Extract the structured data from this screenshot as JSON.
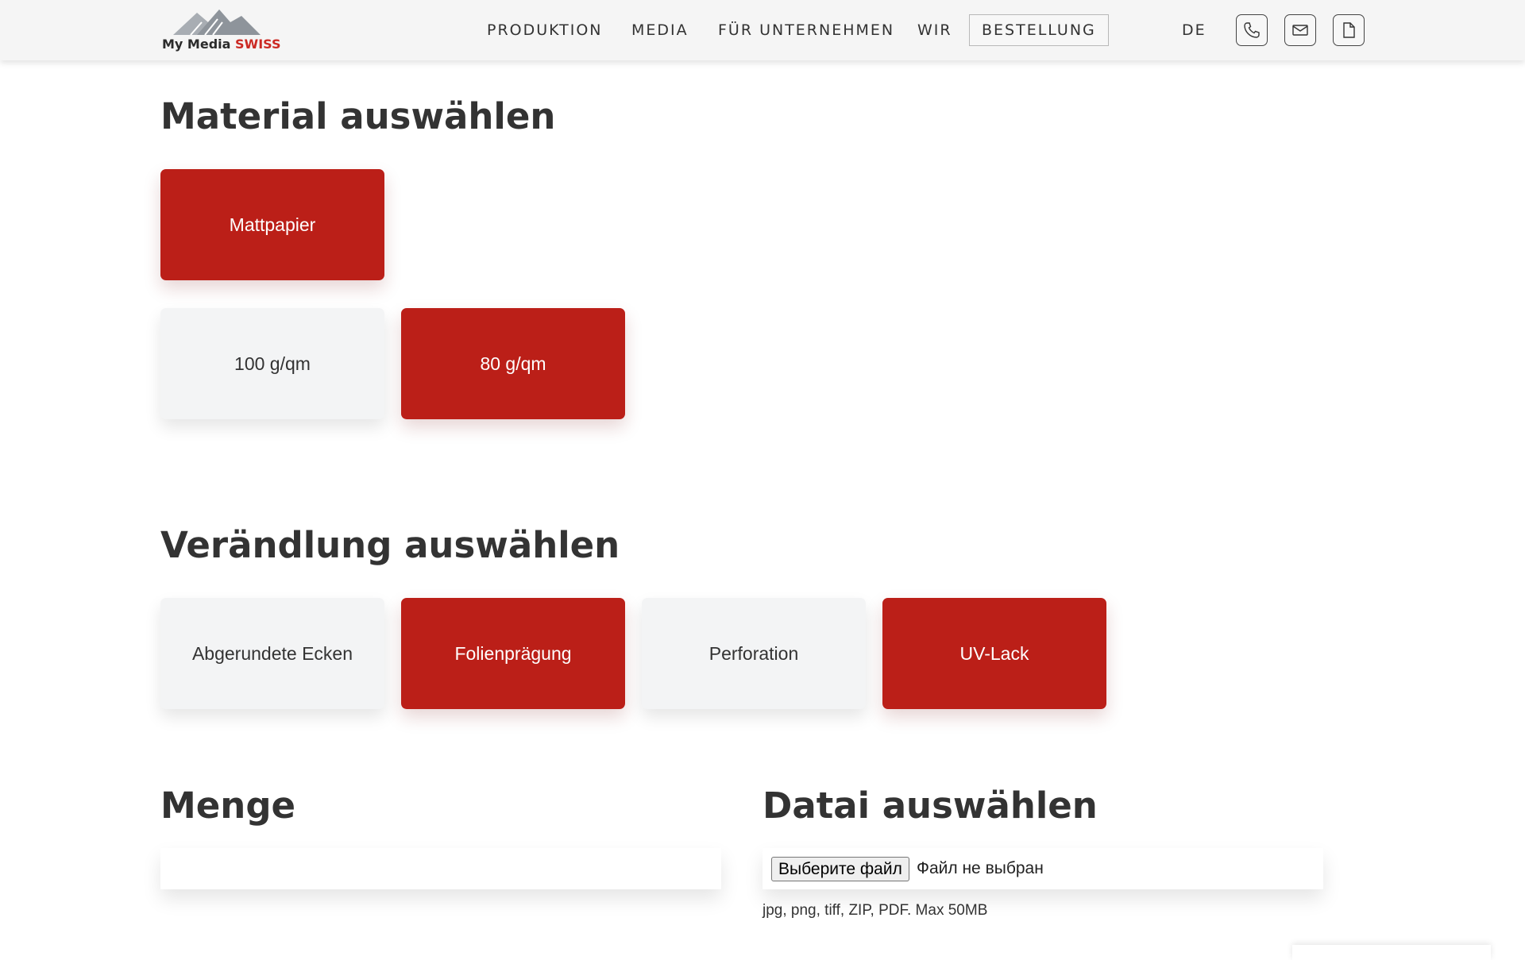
{
  "header": {
    "logo": {
      "text_main": "My Media",
      "text_accent": "SWISS"
    },
    "nav": [
      {
        "label": "PRODUKTION"
      },
      {
        "label": "MEDIA"
      },
      {
        "label": "FÜR UNTERNEHMEN"
      },
      {
        "label": "WIR"
      },
      {
        "label": "BESTELLUNG"
      }
    ],
    "language": "DE",
    "icons": [
      "phone-icon",
      "mail-icon",
      "document-icon"
    ]
  },
  "material": {
    "title": "Material auswählen",
    "type_options": [
      {
        "label": "Mattpapier",
        "selected": true
      }
    ],
    "weight_options": [
      {
        "label": "100 g/qm",
        "selected": false
      },
      {
        "label": "80 g/qm",
        "selected": true
      }
    ]
  },
  "finishing": {
    "title": "Verändlung auswählen",
    "options": [
      {
        "label": "Abgerundete Ecken",
        "selected": false
      },
      {
        "label": "Folienprägung",
        "selected": true
      },
      {
        "label": "Perforation",
        "selected": false
      },
      {
        "label": "UV-Lack",
        "selected": true
      }
    ]
  },
  "quantity": {
    "title": "Menge",
    "value": ""
  },
  "file": {
    "title": "Datai auswählen",
    "button_label": "Выберите файл",
    "status": "Файл не выбран",
    "hint": "jpg, png, tiff, ZIP, PDF. Max 50MB"
  },
  "colors": {
    "accent": "#bb1f18",
    "option_inactive": "#f3f4f5",
    "header_bg": "#f5f5f5"
  }
}
